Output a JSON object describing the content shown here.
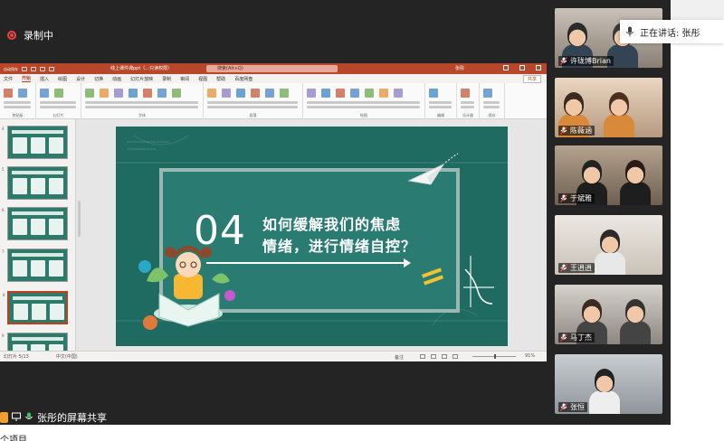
{
  "meeting": {
    "recording_label": "录制中",
    "speaker_label": "正在讲话: 张彤",
    "share_label": "张彤的屏幕共享",
    "bottom_text": "个项目"
  },
  "ppt": {
    "title_left": "自动保存",
    "file_name": "线上课件课ppt（..·只读权限）",
    "search_placeholder": "搜索(Alt+Q)",
    "user": "张彤",
    "tabs": [
      "文件",
      "开始",
      "插入",
      "绘图",
      "设计",
      "切换",
      "动画",
      "幻灯片放映",
      "录制",
      "审阅",
      "视图",
      "帮助",
      "百度网盘"
    ],
    "active_tab": "开始",
    "share_button": "共享",
    "ribbon_groups": [
      "剪贴板",
      "幻灯片",
      "字体",
      "段落",
      "绘图",
      "编辑",
      "设计器",
      "保存"
    ],
    "status_left": "幻灯片 5/13",
    "status_lang": "中文(中国)",
    "status_notes": "备注",
    "zoom": "91%"
  },
  "thumbnails": [
    {
      "number": "4"
    },
    {
      "number": "5"
    },
    {
      "number": "6"
    },
    {
      "number": "7"
    },
    {
      "number": "8",
      "selected": true
    },
    {
      "number": "9"
    }
  ],
  "slide": {
    "number": "04",
    "line1": "如何缓解我们的焦虑",
    "line2": "情绪，进行情绪自控？",
    "colors": {
      "bg": "#1f6b62",
      "frame": "#9ab8b2",
      "accent": "#f1c232"
    }
  },
  "participants": [
    {
      "name": "许珑博Brian"
    },
    {
      "name": "陈薇涵"
    },
    {
      "name": "于斌雅"
    },
    {
      "name": "王逍逍"
    },
    {
      "name": "马丁杰"
    },
    {
      "name": "张恒"
    }
  ],
  "colors": {
    "ppt_accent": "#b7472a",
    "meeting_bg": "#242424"
  }
}
